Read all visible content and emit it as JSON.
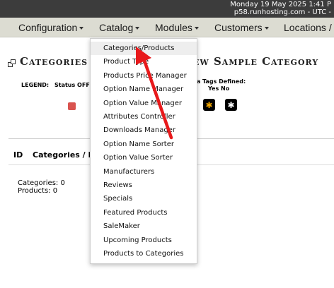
{
  "topbar": {
    "datetime": "Monday 19 May 2025 1:41 P",
    "host": "p58.runhosting.com - UTC -"
  },
  "menubar": {
    "items": [
      {
        "label": "Configuration"
      },
      {
        "label": "Catalog"
      },
      {
        "label": "Modules"
      },
      {
        "label": "Customers"
      },
      {
        "label": "Locations / T"
      }
    ]
  },
  "page": {
    "title_left": "Categories",
    "title_right": "ew Sample Category",
    "legend_label": "LEGEND:",
    "status_label": "Status OFF",
    "meta_tags_label": "ta Tags Defined:",
    "meta_yes": "Yes",
    "meta_no": "No",
    "meta_icon_glyph": "✱"
  },
  "table": {
    "col_id": "ID",
    "col_categories": "Categories / P"
  },
  "counts": {
    "categories": "Categories: 0",
    "products": "Products: 0"
  },
  "catalog_menu": {
    "items": [
      "Categories/Products",
      "Product Type",
      "Products Price Manager",
      "Option Name Manager",
      "Option Value Manager",
      "Attributes Controller",
      "Downloads Manager",
      "Option Name Sorter",
      "Option Value Sorter",
      "Manufacturers",
      "Reviews",
      "Specials",
      "Featured Products",
      "SaleMaker",
      "Upcoming Products",
      "Products to Categories"
    ]
  },
  "colors": {
    "topbar": "#3c3c3c",
    "menubar": "#dcdcd2",
    "status_off": "#d9534f",
    "meta_yes": "#f0a500",
    "annotation_arrow": "#e8191b"
  }
}
